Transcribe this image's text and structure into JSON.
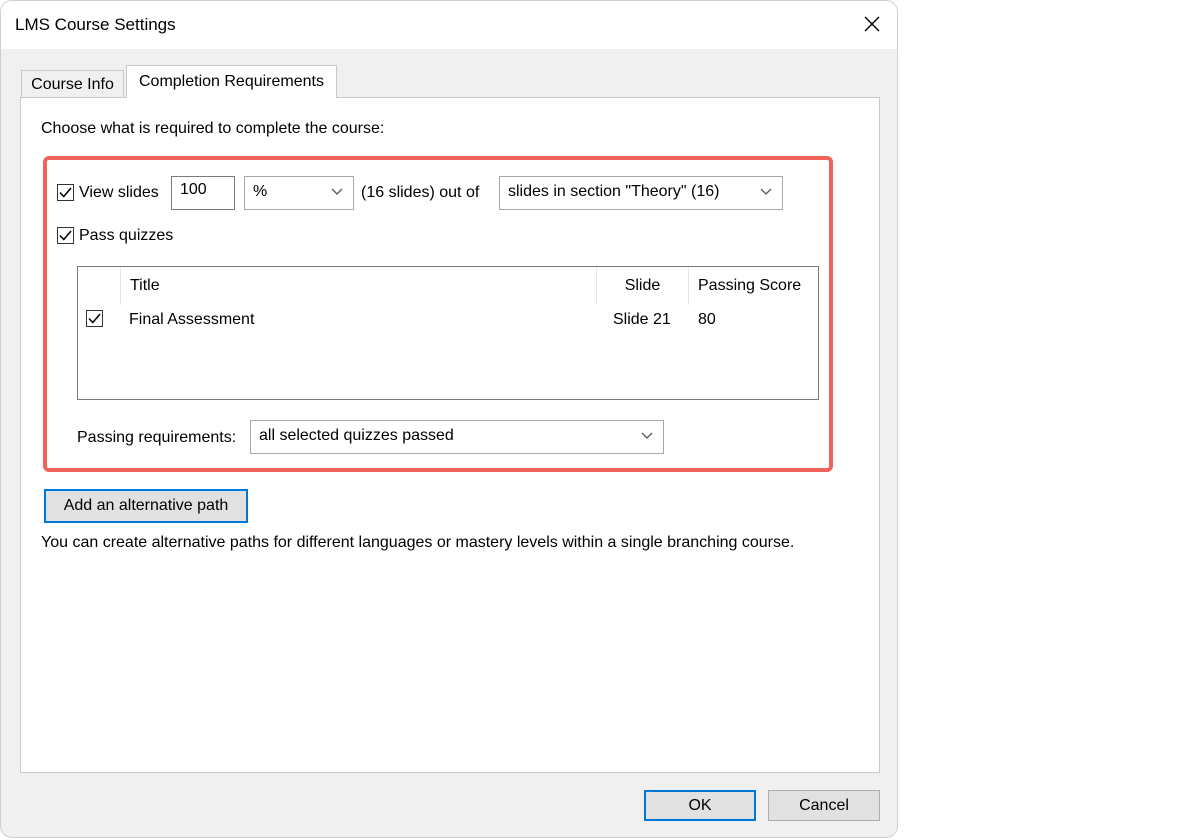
{
  "window": {
    "title": "LMS Course Settings"
  },
  "tabs": [
    {
      "label": "Course Info"
    },
    {
      "label": "Completion Requirements"
    }
  ],
  "panel": {
    "instruction": "Choose what is required to complete the course:",
    "view_slides": {
      "label": "View slides",
      "checked": true,
      "amount": "100",
      "unit": "%",
      "count_text": "(16 slides) out of",
      "scope": "slides in section \"Theory\" (16)"
    },
    "pass_quizzes": {
      "label": "Pass quizzes",
      "checked": true
    },
    "quiz_table": {
      "headers": {
        "title": "Title",
        "slide": "Slide",
        "score": "Passing Score"
      },
      "rows": [
        {
          "checked": true,
          "title": "Final Assessment",
          "slide": "Slide 21",
          "score": "80"
        }
      ]
    },
    "passing_requirements": {
      "label": "Passing requirements:",
      "value": "all selected quizzes passed"
    },
    "alt_path_button": "Add an alternative path",
    "alt_path_info": "You can create alternative paths for different languages or mastery levels within a single branching course."
  },
  "footer": {
    "ok": "OK",
    "cancel": "Cancel"
  },
  "colors": {
    "highlight": "#f0635a",
    "focus": "#0078d7",
    "dialog_bg": "#f0f0f0"
  }
}
